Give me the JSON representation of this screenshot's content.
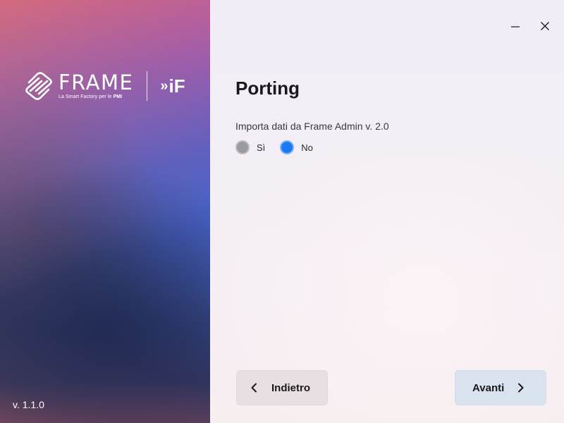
{
  "brand": {
    "name": "FRAME",
    "tagline_prefix": "La Smart Factory per le ",
    "tagline_bold": "PMI",
    "partner_chevrons": "»",
    "partner_logo": "iF"
  },
  "app": {
    "version": "v. 1.1.0"
  },
  "window": {
    "minimize_icon": "minimize-icon",
    "close_icon": "close-icon"
  },
  "page": {
    "title": "Porting",
    "import_label": "Importa dati da Frame Admin v. 2.0",
    "options": [
      {
        "label": "Sì",
        "selected": false
      },
      {
        "label": "No",
        "selected": true
      }
    ]
  },
  "navigation": {
    "back_label": "Indietro",
    "next_label": "Avanti"
  },
  "colors": {
    "accent": "#1a7bf0",
    "radio_unselected": "#9a9a9f",
    "back_button_bg": "#e7dfe1",
    "next_button_bg": "#d9e3ef"
  }
}
